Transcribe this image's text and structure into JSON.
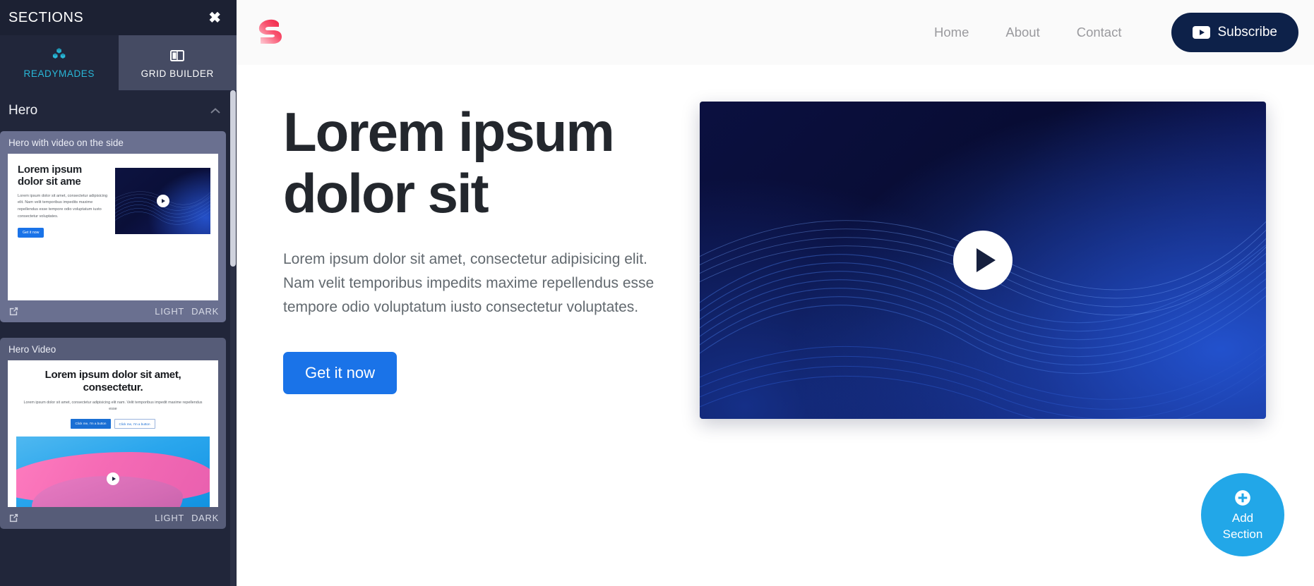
{
  "sidebar": {
    "title": "SECTIONS",
    "close_icon": "close-icon",
    "tabs": [
      {
        "label": "READYMADES",
        "icon": "blocks-icon",
        "active": true
      },
      {
        "label": "GRID BUILDER",
        "icon": "columns-icon",
        "active": false
      }
    ],
    "group": {
      "title": "Hero",
      "chevron": "chevron-up-icon"
    },
    "footer_buttons": {
      "light": "LIGHT",
      "dark": "DARK",
      "open_icon": "external-link-icon"
    },
    "cards": [
      {
        "title": "Hero with video on the side",
        "selected": true,
        "preview": {
          "heading": "Lorem ipsum dolor sit ame",
          "paragraph": "Lorem ipsum dolor sit amet, consectetur adipisicing elit. Nam velit temporibus impedits maxime repellendus esse tempore odio voluptatum iusto consectetur voluptates.",
          "button": "Get it now",
          "play_icon": "play-icon"
        }
      },
      {
        "title": "Hero Video",
        "selected": false,
        "preview": {
          "heading": "Lorem ipsum dolor sit amet, consectetur.",
          "paragraph": "Lorem ipsum dolor sit amet, consectetur adipisicing elit nam. Velit temporibus impedit maxime repellendus esse",
          "button_primary": "Click me, I'm a button",
          "button_secondary": "Click me, I'm a button",
          "play_icon": "play-icon"
        }
      }
    ]
  },
  "site": {
    "logo_icon": "s-logo-icon",
    "nav": [
      {
        "label": "Home"
      },
      {
        "label": "About"
      },
      {
        "label": "Contact"
      }
    ],
    "subscribe": {
      "label": "Subscribe",
      "icon": "youtube-play-icon"
    },
    "hero": {
      "heading": "Lorem ipsum dolor sit",
      "paragraph": "Lorem ipsum dolor sit amet, consectetur adipisicing elit. Nam velit temporibus impedits maxime repellendus esse tempore odio voluptatum iusto consectetur voluptates.",
      "cta": "Get it now",
      "video_play_icon": "play-icon"
    }
  },
  "add_section": {
    "line1": "Add",
    "line2": "Section",
    "icon": "plus-circle-icon"
  },
  "colors": {
    "sidebar_bg": "#21263a",
    "sidebar_header_bg": "#1c2133",
    "tab_active_cyan": "#29b8d8",
    "tab_panel_bg": "#454b63",
    "card_selected_bg": "#6a7090",
    "card_bg": "#565c78",
    "cta_blue": "#1a73e8",
    "subscribe_navy": "#0d2149",
    "fab_cyan": "#22a7e8",
    "heading_dark": "#23272d",
    "body_text": "#62696f",
    "nav_text": "#9a9a9e",
    "logo_red": "#f2304f",
    "video_navy": "#0b1040"
  }
}
